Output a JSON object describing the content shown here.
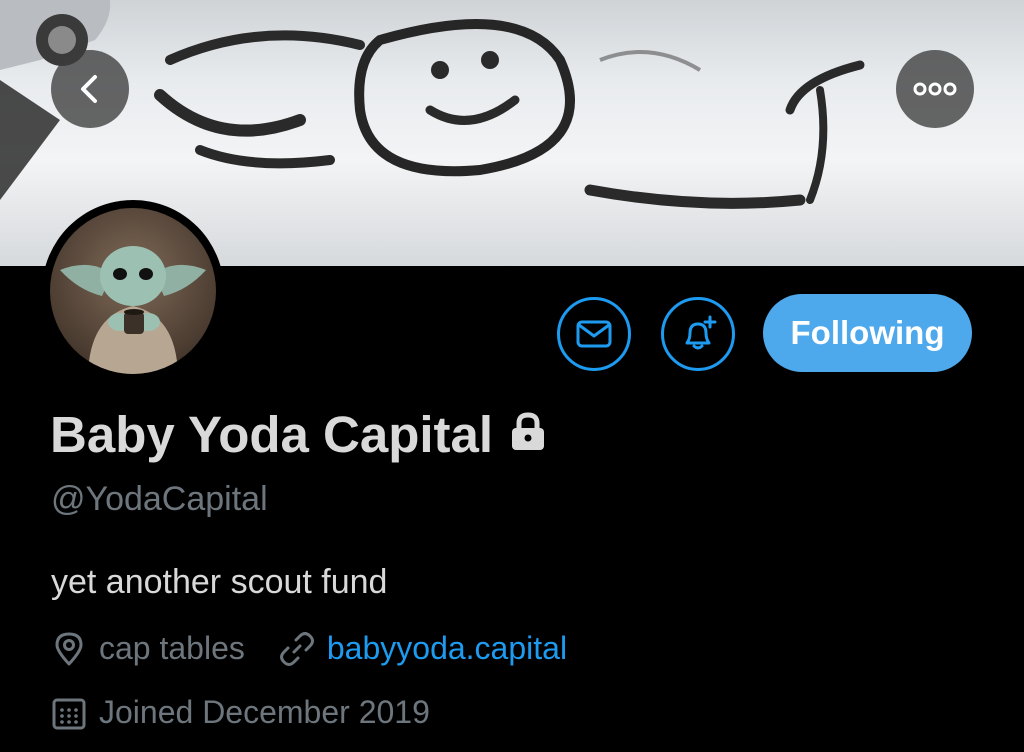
{
  "profile": {
    "display_name": "Baby Yoda Capital",
    "handle": "@YodaCapital",
    "bio": "yet another scout fund",
    "location": "cap tables",
    "website": "babyyoda.capital",
    "joined": "Joined December 2019"
  },
  "actions": {
    "follow_label": "Following"
  },
  "icons": {
    "back": "chevron-left-icon",
    "more": "more-horizontal-icon",
    "mail": "mail-icon",
    "bell": "bell-plus-icon",
    "lock": "lock-icon",
    "location": "location-pin-icon",
    "link": "link-icon",
    "calendar": "calendar-icon"
  },
  "colors": {
    "background": "#000000",
    "accent": "#1d9bf0",
    "follow_button": "#4ea8ec",
    "secondary_text": "#6e767d",
    "primary_text": "#d9d9d9"
  }
}
